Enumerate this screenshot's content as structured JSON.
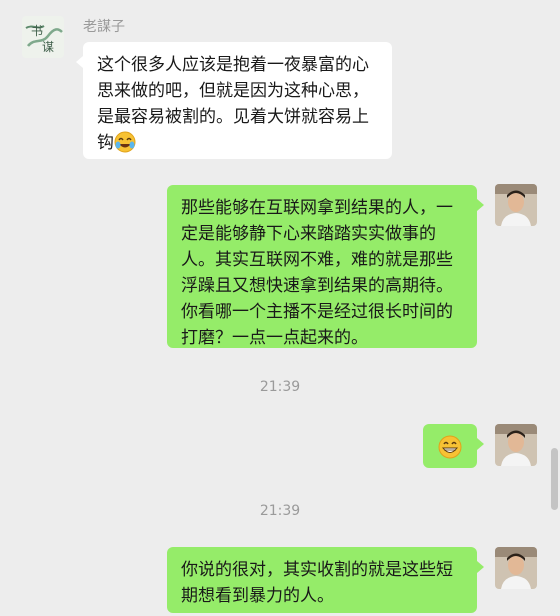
{
  "incoming": {
    "sender_name": "老謀子",
    "text": "这个很多人应该是抱着一夜暴富的心思来做的吧，但就是因为这种心思，是最容易被割的。见着大饼就容易上钩",
    "emoji_icon": "crying-laughing-emoji-icon"
  },
  "outgoing": [
    {
      "text": "那些能够在互联网拿到结果的人，一定是能够静下心来踏踏实实做事的人。其实互联网不难，难的就是那些浮躁且又想快速拿到结果的高期待。你看哪一个主播不是经过很长时间的打磨？一点一点起来的。"
    },
    {
      "emoji_icon": "grinning-emoji-icon"
    },
    {
      "text": "你说的很对，其实收割的就是这些短期想看到暴力的人。"
    }
  ],
  "timestamps": [
    "21:39",
    "21:39"
  ],
  "colors": {
    "background": "#ededed",
    "incoming_bubble": "#ffffff",
    "outgoing_bubble": "#95ec69",
    "meta_text": "#9a9a9a"
  }
}
